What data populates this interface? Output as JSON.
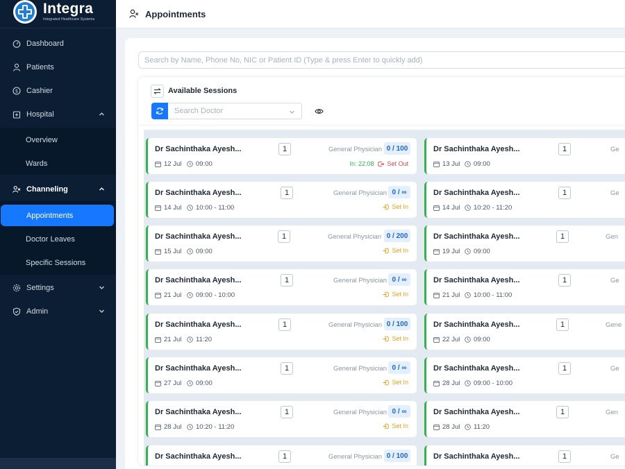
{
  "brand": {
    "name": "Integra",
    "tagline": "Integrated Healthcare Systems"
  },
  "header": {
    "title": "Appointments"
  },
  "sidebar": {
    "items": [
      {
        "label": "Dashboard",
        "icon": "dashboard-icon"
      },
      {
        "label": "Patients",
        "icon": "user-icon"
      },
      {
        "label": "Cashier",
        "icon": "dollar-icon"
      },
      {
        "label": "Hospital",
        "icon": "hospital-icon",
        "expanded": true,
        "children": [
          "Overview",
          "Wards"
        ]
      },
      {
        "label": "Channeling",
        "icon": "channeling-icon",
        "expanded": true,
        "children": [
          "Appointments",
          "Doctor Leaves",
          "Specific Sessions"
        ],
        "active_child": "Appointments"
      },
      {
        "label": "Settings",
        "icon": "gear-icon",
        "expanded": false
      },
      {
        "label": "Admin",
        "icon": "shield-icon",
        "expanded": false
      }
    ]
  },
  "search": {
    "placeholder": "Search by Name, Phone No, NIC or Patient ID (Type & press Enter to quickly add)"
  },
  "sessions": {
    "title": "Available Sessions",
    "doctor_placeholder": "Search Doctor",
    "left": [
      {
        "doctor": "Dr Sachinthaka Ayesh...",
        "qty": "1",
        "specialty": "General Physician",
        "count": "0 / 100",
        "date": "12 Jul",
        "time": "09:00",
        "in": "In: 22:08",
        "out": "Set Out"
      },
      {
        "doctor": "Dr Sachinthaka Ayesh...",
        "qty": "1",
        "specialty": "General Physician",
        "count": "0 / ∞",
        "date": "14 Jul",
        "time": "10:00 - 11:00",
        "status": "Set In"
      },
      {
        "doctor": "Dr Sachinthaka Ayesh...",
        "qty": "1",
        "specialty": "General Physician",
        "count": "0 / 200",
        "date": "15 Jul",
        "time": "09:00",
        "status": "Set In"
      },
      {
        "doctor": "Dr Sachinthaka Ayesh...",
        "qty": "1",
        "specialty": "General Physician",
        "count": "0 / ∞",
        "date": "21 Jul",
        "time": "09:00 - 10:00",
        "status": "Set In"
      },
      {
        "doctor": "Dr Sachinthaka Ayesh...",
        "qty": "1",
        "specialty": "General Physician",
        "count": "0 / 100",
        "date": "21 Jul",
        "time": "11:20",
        "status": "Set In"
      },
      {
        "doctor": "Dr Sachinthaka Ayesh...",
        "qty": "1",
        "specialty": "General Physician",
        "count": "0 / ∞",
        "date": "27 Jul",
        "time": "09:00",
        "status": "Set In"
      },
      {
        "doctor": "Dr Sachinthaka Ayesh...",
        "qty": "1",
        "specialty": "General Physician",
        "count": "0 / ∞",
        "date": "28 Jul",
        "time": "10:20 - 11:20",
        "status": "Set In"
      },
      {
        "doctor": "Dr Sachinthaka Ayesh...",
        "qty": "1",
        "specialty": "General Physician",
        "count": "0 / 100",
        "date": "",
        "time": "",
        "status": ""
      }
    ],
    "right": [
      {
        "doctor": "Dr Sachinthaka Ayesh...",
        "qty": "1",
        "specialty": "Ge",
        "date": "13 Jul",
        "time": "09:00"
      },
      {
        "doctor": "Dr Sachinthaka Ayesh...",
        "qty": "1",
        "specialty": "Ge",
        "date": "14 Jul",
        "time": "10:20 - 11:20"
      },
      {
        "doctor": "Dr Sachinthaka Ayesh...",
        "qty": "1",
        "specialty": "Gen",
        "date": "19 Jul",
        "time": "09:00"
      },
      {
        "doctor": "Dr Sachinthaka Ayesh...",
        "qty": "1",
        "specialty": "Ge",
        "date": "21 Jul",
        "time": "10:00 - 11:00"
      },
      {
        "doctor": "Dr Sachinthaka Ayesh...",
        "qty": "1",
        "specialty": "Gene",
        "date": "22 Jul",
        "time": "09:00"
      },
      {
        "doctor": "Dr Sachinthaka Ayesh...",
        "qty": "1",
        "specialty": "Ge",
        "date": "28 Jul",
        "time": "09:00 - 10:00"
      },
      {
        "doctor": "Dr Sachinthaka Ayesh...",
        "qty": "1",
        "specialty": "Gen",
        "date": "28 Jul",
        "time": "11:20"
      },
      {
        "doctor": "Dr Sachinthaka Ayesh...",
        "qty": "1",
        "specialty": "Ge",
        "date": "",
        "time": ""
      }
    ]
  },
  "colors": {
    "sidebar": "#0b1e33",
    "accent": "#1677ff",
    "session_border": "#34b24b",
    "set_in": "#e8a11a",
    "set_out": "#e64a4a"
  }
}
